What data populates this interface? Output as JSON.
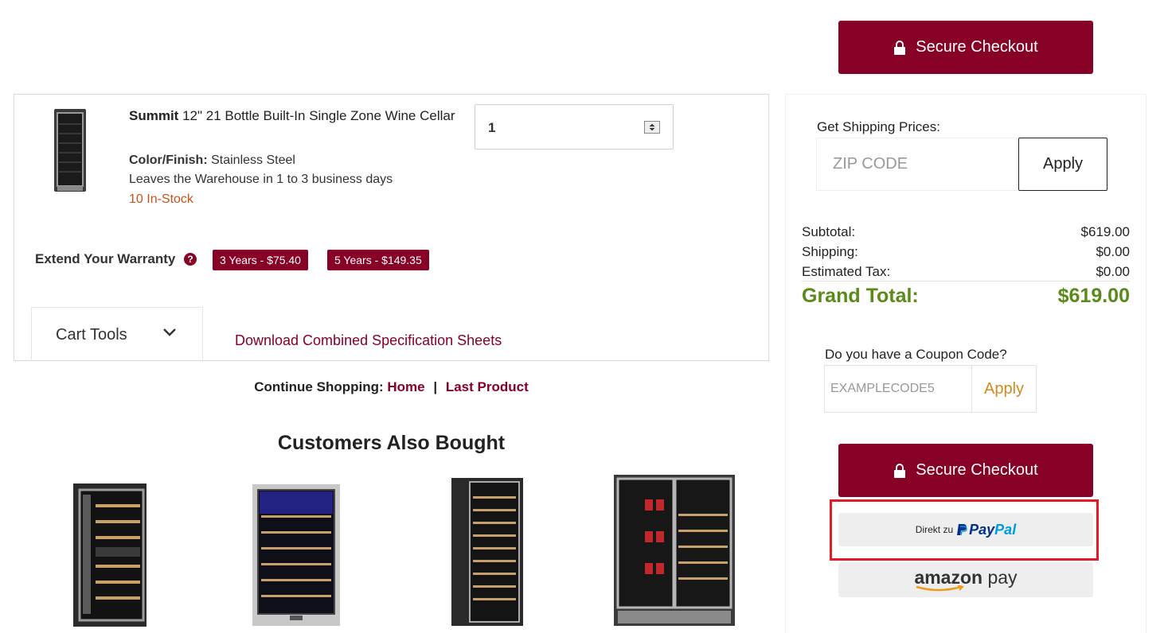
{
  "checkout": {
    "label": "Secure Checkout"
  },
  "cart_item": {
    "brand": "Summit",
    "title": " 12\" 21 Bottle Built-In Single Zone Wine Cellar",
    "quantity": "1",
    "color_label": "Color/Finish:",
    "color_value": " Stainless Steel",
    "ship_time": "Leaves the Warehouse in 1 to 3 business days",
    "stock": "10 In-Stock"
  },
  "warranty": {
    "label": "Extend Your Warranty",
    "help": "?",
    "options": [
      "3 Years - $75.40",
      "5 Years - $149.35"
    ]
  },
  "cart_tools": {
    "label": "Cart Tools"
  },
  "spec_link": "Download Combined Specification Sheets",
  "continue_shopping": {
    "label": "Continue Shopping:",
    "home": "Home",
    "separator": "|",
    "last_product": "Last Product"
  },
  "also_bought": {
    "title": "Customers Also Bought"
  },
  "shipping": {
    "label": "Get Shipping Prices:",
    "zip_placeholder": "ZIP CODE",
    "apply": "Apply"
  },
  "totals": {
    "subtotal_label": "Subtotal:",
    "subtotal": "$619.00",
    "shipping_label": "Shipping:",
    "shipping": "$0.00",
    "tax_label": "Estimated Tax:",
    "tax": "$0.00",
    "grand_label": "Grand Total:",
    "grand": "$619.00"
  },
  "coupon": {
    "label": "Do you have a Coupon Code?",
    "placeholder": "EXAMPLECODE5",
    "apply": "Apply"
  },
  "paypal": {
    "prefix": "Direkt zu",
    "brand1": "Pay",
    "brand2": "Pal"
  },
  "amazon": {
    "brand1": "amazon",
    "brand2": " pay"
  },
  "colors": {
    "brand": "#870026",
    "grand_total": "#5a8a1a",
    "stock": "#c8511b",
    "highlight": "#e31b23"
  }
}
